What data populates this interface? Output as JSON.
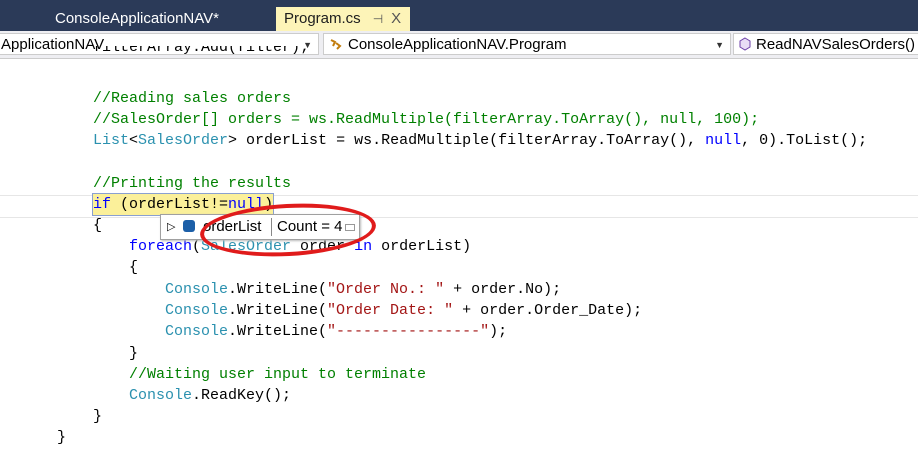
{
  "tabs": [
    {
      "label": "ConsoleApplicationNAV*"
    },
    {
      "label": "Program.cs",
      "pin": "⊣",
      "close": "X"
    }
  ],
  "nav": {
    "project": "ApplicationNAV",
    "class": "ConsoleApplicationNAV.Program",
    "member": "ReadNAVSalesOrders()"
  },
  "code": [
    "filterArray.Add(filter);",
    "//Reading sales orders",
    "//SalesOrder[] orders = ws.ReadMultiple(filterArray.ToArray(), null, 100);",
    "List<SalesOrder> orderList = ws.ReadMultiple(filterArray.ToArray(), null, 0).ToList();",
    "//Printing the results",
    "if (orderList!=null)",
    "{",
    "foreach(SalesOrder order in orderList)",
    "{",
    "Console.WriteLine(\"Order No.: \" + order.No);",
    "Console.WriteLine(\"Order Date: \" + order.Order_Date);",
    "Console.WriteLine(\"----------------\");",
    "}",
    "//Waiting user input to terminate",
    "Console.ReadKey();",
    "}",
    "}"
  ],
  "datatip": {
    "name": "orderList",
    "value": "Count = 4"
  }
}
